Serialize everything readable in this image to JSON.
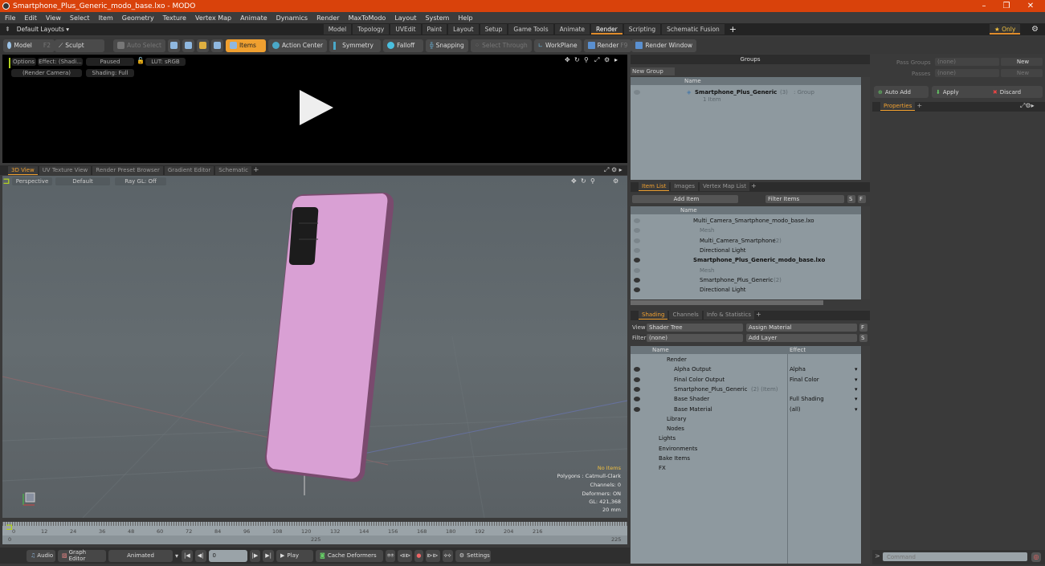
{
  "window": {
    "title": "Smartphone_Plus_Generic_modo_base.lxo - MODO",
    "controls": [
      "–",
      "❐",
      "✕"
    ]
  },
  "menu": [
    "File",
    "Edit",
    "View",
    "Select",
    "Item",
    "Geometry",
    "Texture",
    "Vertex Map",
    "Animate",
    "Dynamics",
    "Render",
    "MaxToModo",
    "Layout",
    "System",
    "Help"
  ],
  "layouts": {
    "label": "Default Layouts ▾",
    "tabs": [
      "Model",
      "Topology",
      "UVEdit",
      "Paint",
      "Layout",
      "Setup",
      "Game Tools",
      "Animate",
      "Render",
      "Scripting",
      "Schematic Fusion"
    ],
    "active": "Render",
    "plus": "+",
    "only": "★ Only"
  },
  "toolbar": {
    "model": "Model",
    "model_key": "F2",
    "sculpt": "Sculpt",
    "auto_select": "Auto Select",
    "items": "Items",
    "action_center": "Action Center",
    "symmetry": "Symmetry",
    "falloff": "Falloff",
    "snapping": "Snapping",
    "select_through": "Select Through",
    "workplane": "WorkPlane",
    "render": "Render",
    "render_key": "F9",
    "render_window": "Render Window"
  },
  "preview": {
    "options": "Options",
    "effect": "Effect: (Shadi...",
    "paused": "Paused",
    "lut": "LUT: sRGB",
    "camera": "(Render Camera)",
    "shading": "Shading: Full"
  },
  "viewport_tabs": [
    "3D View",
    "UV Texture View",
    "Render Preset Browser",
    "Gradient Editor",
    "Schematic",
    "+"
  ],
  "viewport": {
    "perspective": "Perspective",
    "default": "Default",
    "raygl": "Ray GL: Off",
    "info": [
      "No Items",
      "Polygons : Catmull-Clark",
      "Channels: 0",
      "Deformers: ON",
      "GL: 421,368",
      "20 mm"
    ]
  },
  "timeline": {
    "ticks": [
      "0",
      "12",
      "24",
      "36",
      "48",
      "60",
      "72",
      "84",
      "96",
      "108",
      "120",
      "132",
      "144",
      "156",
      "168",
      "180",
      "192",
      "204",
      "216"
    ],
    "start": "0",
    "mid": "225",
    "end": "225"
  },
  "bottom": {
    "audio": "Audio",
    "graph_editor": "Graph Editor",
    "animated": "Animated",
    "frame": "0",
    "play": "Play",
    "cache": "Cache Deformers",
    "settings": "Settings"
  },
  "groups": {
    "title": "Groups",
    "new_group": "New Group",
    "name_col": "Name",
    "item_name": "Smartphone_Plus_Generic",
    "item_count": "(3)",
    "item_type": ": Group",
    "item_sub": "1 Item"
  },
  "item_list": {
    "tabs": [
      "Item List",
      "Images",
      "Vertex Map List",
      "+"
    ],
    "add_item": "Add Item",
    "filter": "Filter Items",
    "s": "S",
    "f": "F",
    "name_col": "Name",
    "rows": [
      {
        "label": "Multi_Camera_Smartphone_modo_base.lxo",
        "indent": 0,
        "style": "scene"
      },
      {
        "label": "Mesh",
        "indent": 1,
        "style": "gray"
      },
      {
        "label": "Multi_Camera_Smartphone",
        "suffix": "(2)",
        "indent": 1,
        "style": "normal"
      },
      {
        "label": "Directional Light",
        "indent": 1,
        "style": "normal"
      },
      {
        "label": "Smartphone_Plus_Generic_modo_base.lxo",
        "indent": 0,
        "style": "bold"
      },
      {
        "label": "Mesh",
        "indent": 1,
        "style": "gray"
      },
      {
        "label": "Smartphone_Plus_Generic",
        "suffix": "(2)",
        "indent": 1,
        "style": "normal"
      },
      {
        "label": "Directional Light",
        "indent": 1,
        "style": "normal"
      }
    ]
  },
  "shading": {
    "tabs": [
      "Shading",
      "Channels",
      "Info & Statistics",
      "+"
    ],
    "view_label": "View",
    "view": "Shader Tree",
    "assign": "Assign Material",
    "filter_label": "Filter",
    "filter": "(none)",
    "add_layer": "Add Layer",
    "f": "F",
    "s": "S",
    "name_col": "Name",
    "effect_col": "Effect",
    "rows": [
      {
        "label": "Render",
        "effect": "",
        "indent": 0
      },
      {
        "label": "Alpha Output",
        "effect": "Alpha",
        "indent": 1
      },
      {
        "label": "Final Color Output",
        "effect": "Final Color",
        "indent": 1
      },
      {
        "label": "Smartphone_Plus_Generic",
        "suffix": "(2) (Item)",
        "effect": "",
        "indent": 1
      },
      {
        "label": "Base Shader",
        "effect": "Full Shading",
        "indent": 1
      },
      {
        "label": "Base Material",
        "effect": "(all)",
        "indent": 1
      },
      {
        "label": "Library",
        "effect": "",
        "indent": 0
      },
      {
        "label": "Nodes",
        "effect": "",
        "indent": 0
      },
      {
        "label": "Lights",
        "effect": "",
        "indent": -1
      },
      {
        "label": "Environments",
        "effect": "",
        "indent": -1
      },
      {
        "label": "Bake Items",
        "effect": "",
        "indent": -1
      },
      {
        "label": "FX",
        "effect": "",
        "indent": -1
      }
    ]
  },
  "passes": {
    "pass_groups": "Pass Groups",
    "passes": "Passes",
    "none": "(none)",
    "new": "New",
    "auto_add": "Auto Add",
    "apply": "Apply",
    "discard": "Discard",
    "properties": "Properties",
    "plus": "+"
  },
  "command": {
    "placeholder": "Command"
  }
}
